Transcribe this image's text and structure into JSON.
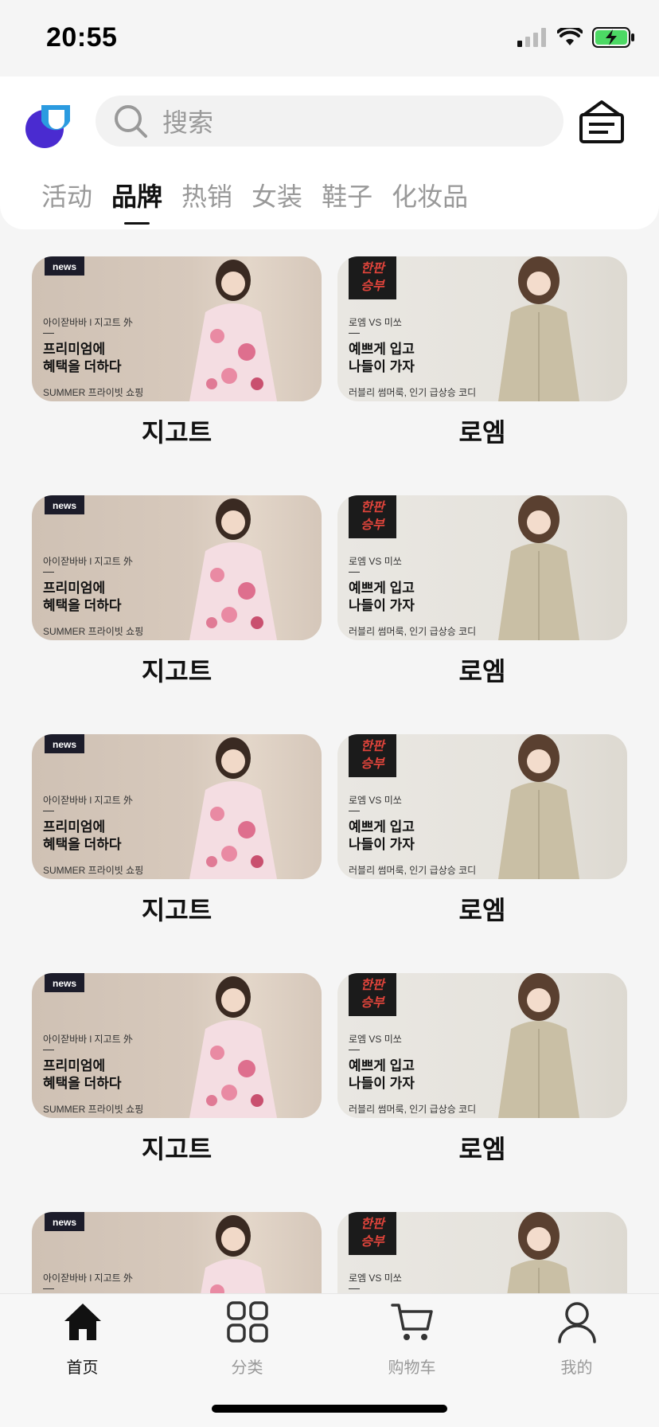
{
  "status": {
    "time": "20:55"
  },
  "search": {
    "placeholder": "搜索"
  },
  "tabs": [
    {
      "label": "活动",
      "active": false
    },
    {
      "label": "品牌",
      "active": true
    },
    {
      "label": "热销",
      "active": false
    },
    {
      "label": "女装",
      "active": false
    },
    {
      "label": "鞋子",
      "active": false
    },
    {
      "label": "化妆品",
      "active": false
    }
  ],
  "brands": [
    {
      "name": "지고트",
      "banner": {
        "badge": "news",
        "small": "아이잗바바 l 지고트 外",
        "title1": "프리미엄에",
        "title2": "혜택을 더하다",
        "foot": "SUMMER 프라이빗 쇼핑"
      }
    },
    {
      "name": "로엠",
      "banner": {
        "badge1": "한판",
        "badge2": "승부",
        "small": "로엠 VS 미쏘",
        "title1": "예쁘게 입고",
        "title2": "나들이 가자",
        "foot": "러블리 썸머룩, 인기 급상승 코디"
      }
    }
  ],
  "nav": [
    {
      "label": "首页",
      "icon": "home-icon",
      "active": true
    },
    {
      "label": "分类",
      "icon": "grid-icon",
      "active": false
    },
    {
      "label": "购物车",
      "icon": "cart-icon",
      "active": false
    },
    {
      "label": "我的",
      "icon": "profile-icon",
      "active": false
    }
  ],
  "colors": {
    "accent_blue": "#2b9be0",
    "accent_purple": "#4a2bd0",
    "battery_green": "#4cd964"
  }
}
